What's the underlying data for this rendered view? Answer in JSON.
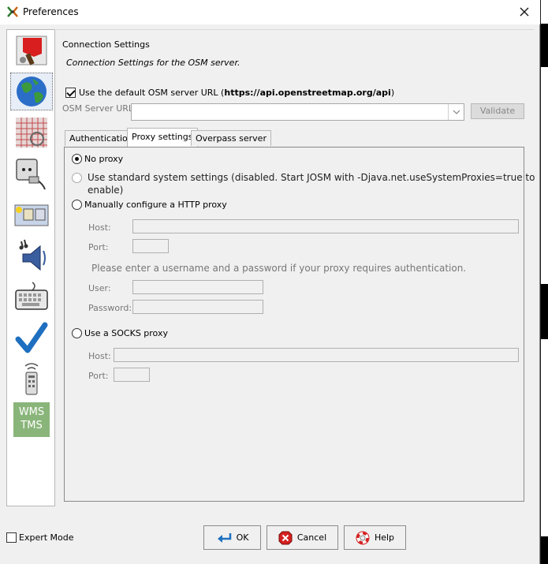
{
  "window": {
    "title": "Preferences"
  },
  "main": {
    "section_title": "Connection Settings",
    "section_desc": "Connection Settings for the OSM server.",
    "default_url_prefix": "Use the default OSM server URL (",
    "default_url": "https://api.openstreetmap.org/api",
    "default_url_suffix": ")",
    "server_url_label": "OSM Server URL:",
    "server_url_value": "",
    "validate_label": "Validate",
    "tabs": [
      {
        "label": "Authentication",
        "active": false
      },
      {
        "label": "Proxy settings",
        "active": true
      },
      {
        "label": "Overpass server",
        "active": false
      }
    ],
    "proxy": {
      "no_proxy": "No proxy",
      "system_line1": "Use standard system settings (disabled. Start JOSM with -Djava.net.useSystemProxies=true to",
      "system_line2": "enable)",
      "manual": "Manually configure a HTTP proxy",
      "host_label": "Host:",
      "port_label": "Port:",
      "auth_note": "Please enter a username and a password if your proxy requires authentication.",
      "user_label": "User:",
      "password_label": "Password:",
      "socks": "Use a SOCKS proxy",
      "socks_host_label": "Host:",
      "socks_port_label": "Port:"
    }
  },
  "sidebar": {
    "items": [
      {
        "icon": "paint-brush-icon"
      },
      {
        "icon": "globe-icon"
      },
      {
        "icon": "map-grid-icon"
      },
      {
        "icon": "power-plug-icon"
      },
      {
        "icon": "toolbar-icon"
      },
      {
        "icon": "speaker-icon"
      },
      {
        "icon": "keyboard-icon"
      },
      {
        "icon": "checkmark-icon"
      },
      {
        "icon": "remote-control-icon"
      },
      {
        "icon": "wms-tms-icon",
        "text_line1": "WMS",
        "text_line2": "TMS"
      }
    ]
  },
  "footer": {
    "expert_mode": "Expert Mode",
    "ok": "OK",
    "cancel": "Cancel",
    "help": "Help"
  },
  "colors": {
    "window_bg": "#f0f0f0",
    "accent_blue": "#1f6fc0",
    "cancel_red": "#d42020"
  }
}
